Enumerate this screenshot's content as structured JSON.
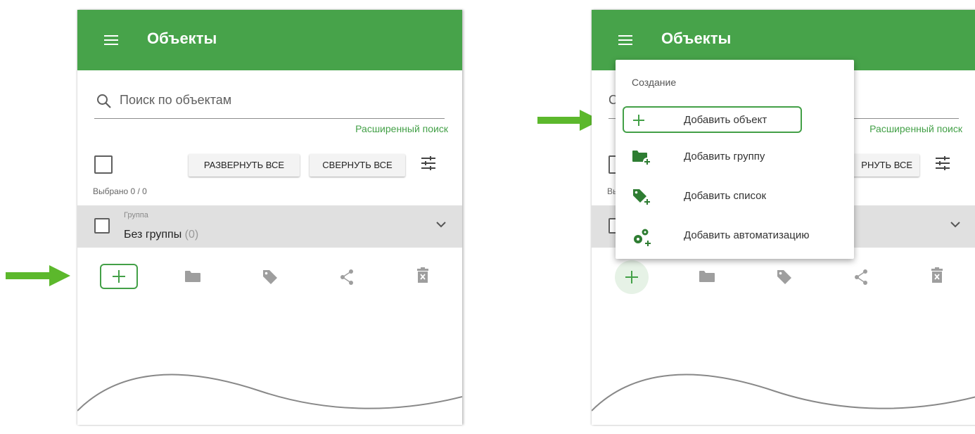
{
  "left_panel": {
    "title": "Объекты",
    "search_placeholder": "Поиск по объектам",
    "advanced_search": "Расширенный поиск",
    "expand_all": "РАЗВЕРНУТЬ ВСЕ",
    "collapse_all": "СВЕРНУТЬ ВСЕ",
    "selected": "Выбрано 0 / 0",
    "group_label": "Группа",
    "group_name": "Без группы",
    "group_count": "(0)"
  },
  "right_panel": {
    "title": "Объекты",
    "search_placeholder_fragment": "С",
    "advanced_search_fragment": "Расширенный поиск",
    "collapse_fragment": "РНУТЬ ВСЕ",
    "selected_fragment": "Вы"
  },
  "menu": {
    "header": "Создание",
    "items": [
      {
        "label": "Добавить объект",
        "icon": "plus-icon"
      },
      {
        "label": "Добавить группу",
        "icon": "folder-plus-icon"
      },
      {
        "label": "Добавить список",
        "icon": "tag-plus-icon"
      },
      {
        "label": "Добавить автоматизацию",
        "icon": "gears-plus-icon"
      }
    ]
  },
  "icons": {
    "action_bar": [
      "plus-icon",
      "folder-icon",
      "tag-icon",
      "share-icon",
      "delete-icon"
    ]
  },
  "colors": {
    "app_bar": "#47a34a",
    "accent": "#43a047",
    "arrow": "#5cb82c",
    "icon_gray": "#9e9e9e"
  }
}
